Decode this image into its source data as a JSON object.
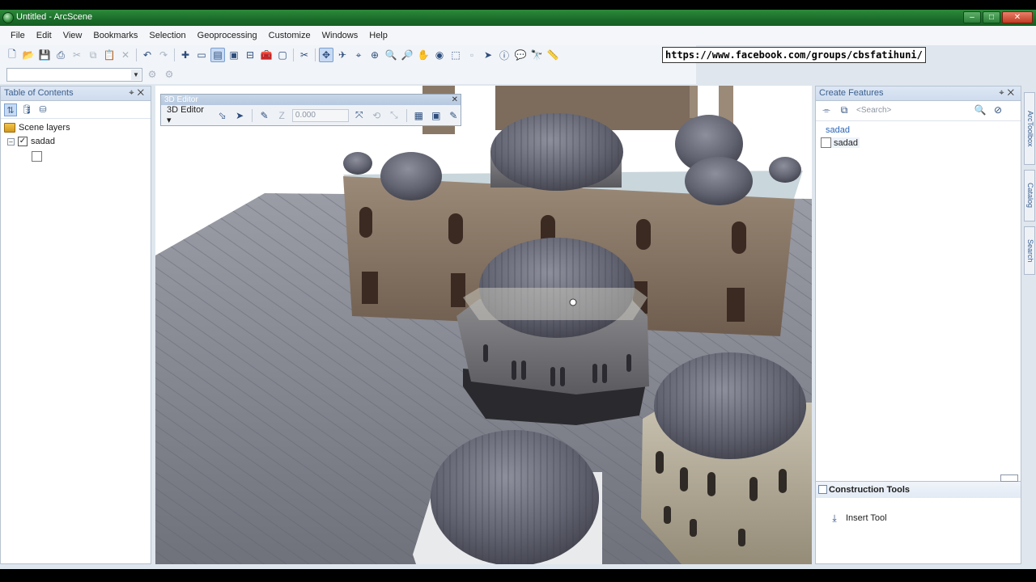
{
  "window": {
    "title": "Untitled - ArcScene",
    "controls": [
      "minimize-icon",
      "maximize-icon",
      "close-icon"
    ]
  },
  "menubar": {
    "items": [
      "File",
      "Edit",
      "View",
      "Bookmarks",
      "Selection",
      "Geoprocessing",
      "Customize",
      "Windows",
      "Help"
    ]
  },
  "overlay": {
    "url": "https://www.facebook.com/groups/cbsfatihuni/"
  },
  "toc": {
    "title": "Table of Contents",
    "root_label": "Scene layers",
    "layer_name": "sadad",
    "layer_checked": true
  },
  "editor3d": {
    "title": "3D Editor",
    "menu_label": "3D Editor ▾",
    "z_value": "0.000"
  },
  "create_features": {
    "title": "Create Features",
    "search_placeholder": "<Search>",
    "layer_group": "sadad",
    "template_name": "sadad"
  },
  "construction_tools": {
    "title": "Construction Tools",
    "tools": [
      "Insert Tool"
    ]
  },
  "dock_tabs": [
    "ArcToolbox",
    "Catalog",
    "Search"
  ],
  "scene": {
    "sky_color": "#ffffff",
    "ground_color": "#7d7f88",
    "dome_color": "#6b6d7a",
    "stone_color": "#8a7664"
  }
}
